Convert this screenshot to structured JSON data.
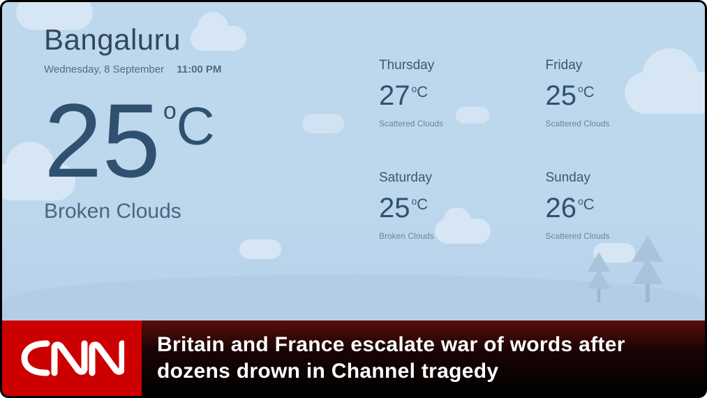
{
  "weather": {
    "city": "Bangaluru",
    "date": "Wednesday, 8 September",
    "time": "11:00 PM",
    "temp": "25",
    "degree": "o",
    "unit": "C",
    "condition": "Broken Clouds"
  },
  "forecast": [
    {
      "day": "Thursday",
      "temp": "27",
      "unit": "C",
      "condition": "Scattered Clouds"
    },
    {
      "day": "Friday",
      "temp": "25",
      "unit": "C",
      "condition": "Scattered Clouds"
    },
    {
      "day": "Saturday",
      "temp": "25",
      "unit": "C",
      "condition": "Broken Clouds"
    },
    {
      "day": "Sunday",
      "temp": "26",
      "unit": "C",
      "condition": "Scattered Clouds"
    }
  ],
  "ticker": {
    "channel": "CNN",
    "headline": "Britain and France escalate war of words after dozens drown in Channel tragedy"
  }
}
